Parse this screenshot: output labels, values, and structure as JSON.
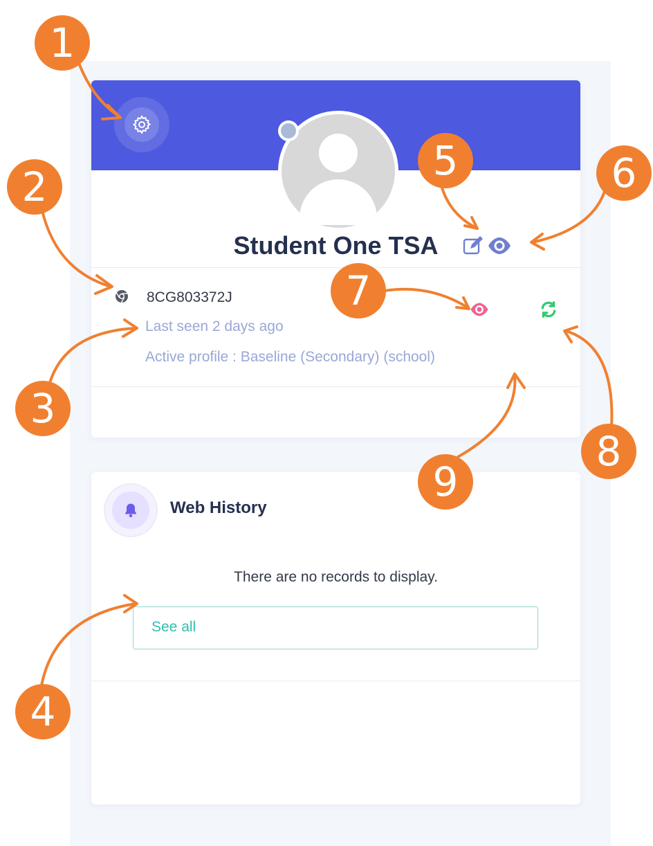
{
  "profile": {
    "name": "Student One TSA",
    "device_id": "8CG803372J",
    "last_seen": "Last seen 2 days ago",
    "active_profile": "Active profile : Baseline (Secondary) (school)"
  },
  "history": {
    "title": "Web History",
    "empty_message": "There are no records to display.",
    "see_all_label": "See all"
  },
  "annotations": [
    "1",
    "2",
    "3",
    "4",
    "5",
    "6",
    "7",
    "8",
    "9"
  ],
  "colors": {
    "banner": "#4d59df",
    "callout": "#f08030",
    "accent_teal": "#2fbfae",
    "view_pink": "#f06292",
    "refresh_green": "#2ecc71",
    "muted_text": "#9aa7d6"
  }
}
